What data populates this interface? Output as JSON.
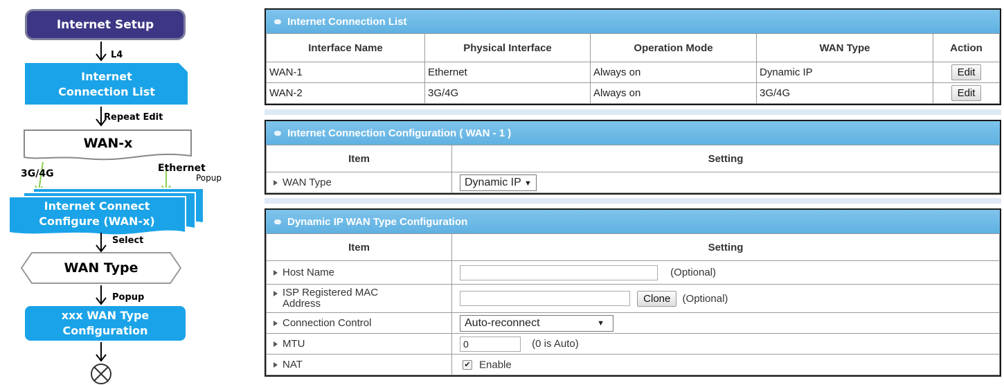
{
  "flow": {
    "start": "Internet Setup",
    "label_l4": "L4",
    "node_list": "Internet\nConnection List",
    "label_repeat": "Repeat Edit",
    "node_wan": "WAN-x",
    "label_3g": "3G/4G",
    "label_eth": "Ethernet",
    "label_popup1": "Popup",
    "node_configure": "Internet Connect\nConfigure (WAN-x)",
    "label_select": "Select",
    "node_wantype": "WAN Type",
    "label_popup2": "Popup",
    "node_typeconfig": "xxx  WAN Type\nConfiguration",
    "colors": {
      "dark": "#3d3685",
      "blue": "#1aa3e8"
    }
  },
  "list_panel": {
    "title": "Internet Connection List",
    "headers": [
      "Interface Name",
      "Physical Interface",
      "Operation Mode",
      "WAN Type",
      "Action"
    ],
    "rows": [
      {
        "name": "WAN-1",
        "phys": "Ethernet",
        "mode": "Always on",
        "type": "Dynamic IP",
        "action": "Edit"
      },
      {
        "name": "WAN-2",
        "phys": "3G/4G",
        "mode": "Always on",
        "type": "3G/4G",
        "action": "Edit"
      }
    ]
  },
  "config_panel": {
    "title": "Internet Connection Configuration ( WAN - 1 )",
    "col_item": "Item",
    "col_setting": "Setting",
    "wan_type_label": "WAN Type",
    "wan_type_value": "Dynamic IP"
  },
  "dyn_panel": {
    "title": "Dynamic IP WAN Type Configuration",
    "col_item": "Item",
    "col_setting": "Setting",
    "host_label": "Host Name",
    "host_value": "",
    "optional": "(Optional)",
    "mac_label": "ISP Registered MAC Address",
    "mac_value": "",
    "clone_label": "Clone",
    "conn_label": "Connection Control",
    "conn_value": "Auto-reconnect",
    "mtu_label": "MTU",
    "mtu_value": "0",
    "mtu_hint": "(0 is Auto)",
    "nat_label": "NAT",
    "nat_checked": true,
    "nat_enable": "Enable"
  }
}
